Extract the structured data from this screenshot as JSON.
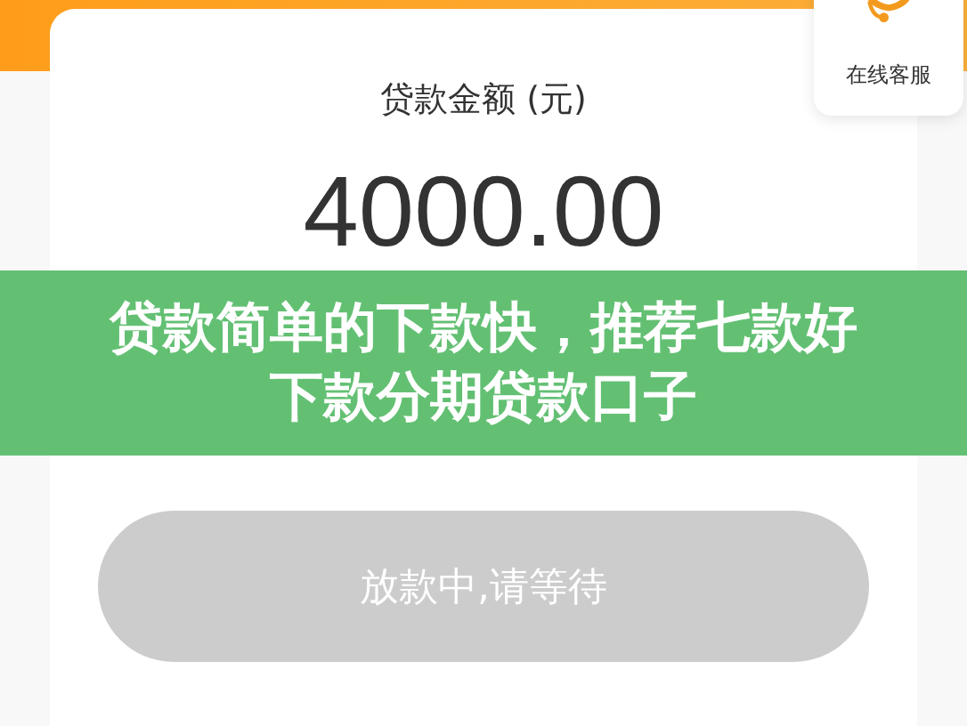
{
  "card": {
    "label": "贷款金额 (元)",
    "amount": "4000.00"
  },
  "service": {
    "label": "在线客服"
  },
  "banner": {
    "title": "贷款简单的下款快，推荐七款好下款分期贷款口子"
  },
  "button": {
    "label": "放款中,请等待",
    "disabled": true
  }
}
